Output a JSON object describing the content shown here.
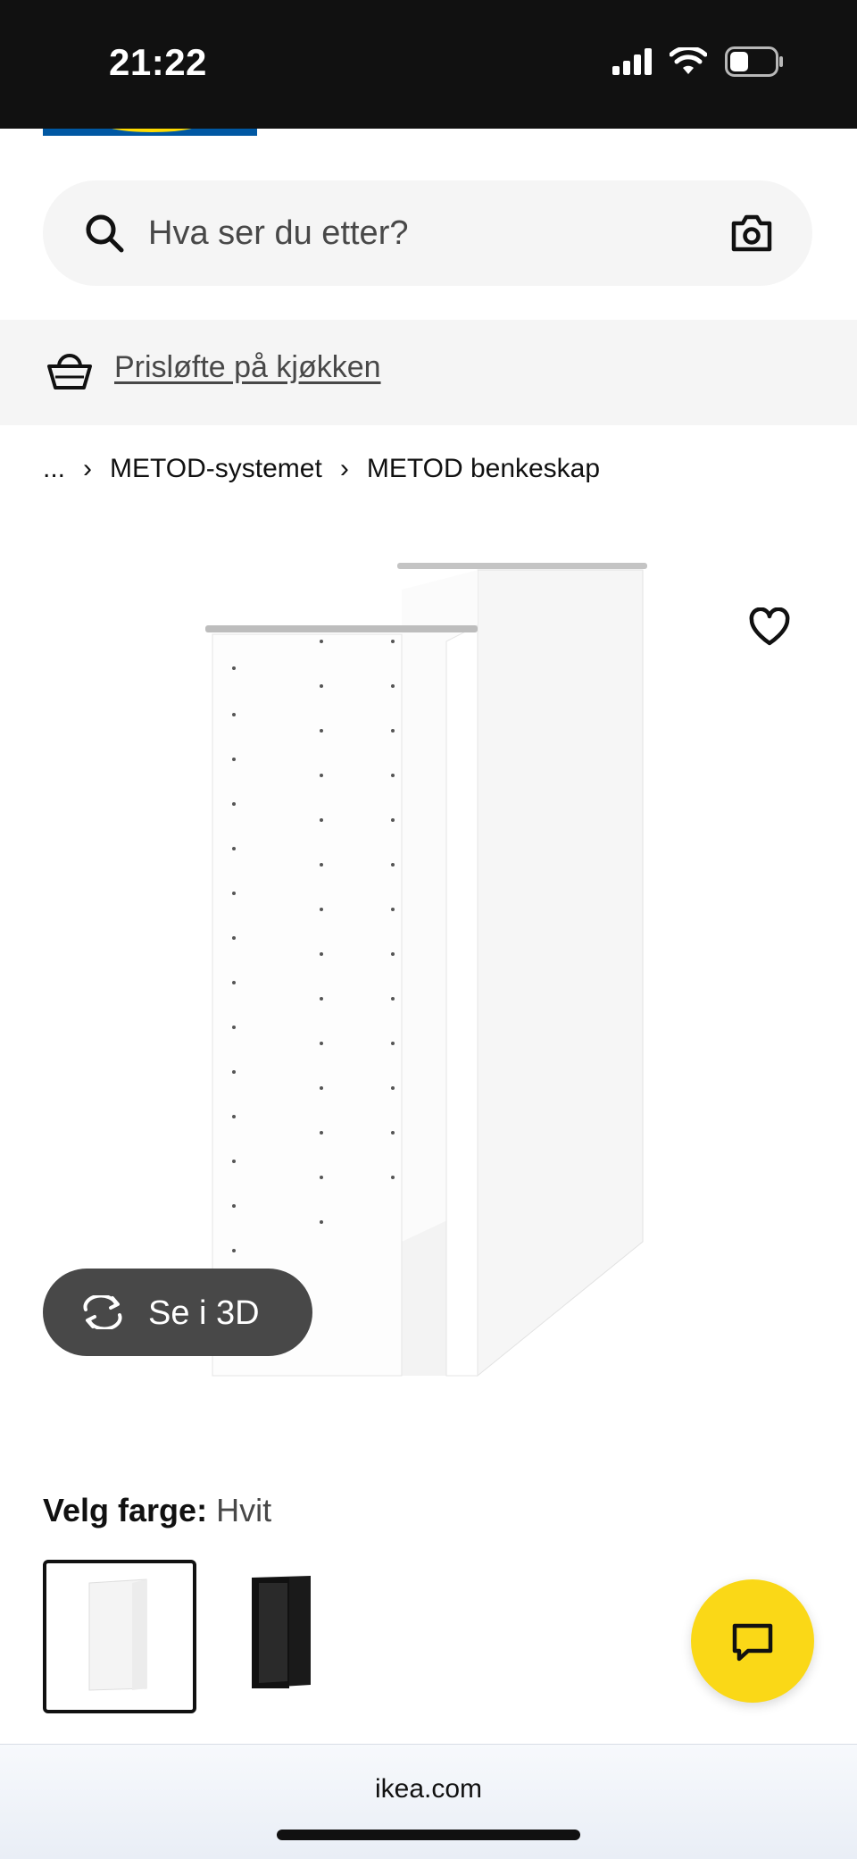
{
  "status_bar": {
    "time": "21:22",
    "icons": [
      "cellular-signal-icon",
      "wifi-icon",
      "battery-icon"
    ]
  },
  "search": {
    "placeholder": "Hva ser du etter?",
    "icons": [
      "search-icon",
      "camera-icon"
    ]
  },
  "promo": {
    "link_text": "Prisløfte på kjøkken",
    "icon": "basket-icon"
  },
  "breadcrumb": {
    "items": [
      "...",
      "METOD-systemet",
      "METOD benkeskap"
    ],
    "separator": "›"
  },
  "product": {
    "view_3d_label": "Se i 3D",
    "favourite_icon": "heart-icon"
  },
  "color_select": {
    "label": "Velg farge:",
    "value": "Hvit",
    "options": [
      {
        "name": "Hvit",
        "selected": true,
        "color": "#ffffff"
      },
      {
        "name": "Svart",
        "selected": false,
        "color": "#111111"
      }
    ]
  },
  "chat": {
    "icon": "chat-icon",
    "color": "#fad817"
  },
  "browser": {
    "url": "ikea.com"
  }
}
